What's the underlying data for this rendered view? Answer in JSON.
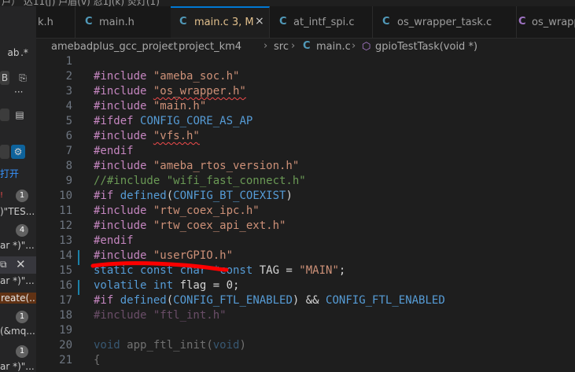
{
  "topbar_fragment": "戸）  込11(ʃ)  戸眉(v)  忍1J(k)  炎灯(1)",
  "sidebar": {
    "regex_icon": ".*",
    "ab_icon": "ab",
    "more_dots": "···",
    "item_open": "打开",
    "rows": [
      {
        "text": ")\"TES...",
        "badge": "1"
      },
      {
        "text": "ar *)\"...",
        "badge": "4"
      },
      {
        "text": "ar *)\"...",
        "badge": ""
      },
      {
        "text": "reate(...",
        "badge": ""
      },
      {
        "text": "(&mq...",
        "badge": "1"
      },
      {
        "text": "ar *)\"...",
        "badge": "1"
      }
    ]
  },
  "tabs": [
    {
      "icon": "C",
      "label": "k.h",
      "active": false
    },
    {
      "icon": "C",
      "label": "main.h",
      "active": false
    },
    {
      "icon": "C",
      "label": "main.c 3, M",
      "active": true
    },
    {
      "icon": "C",
      "label": "at_intf_spi.c",
      "active": false
    },
    {
      "icon": "C",
      "label": "os_wrapper_task.c",
      "active": false
    },
    {
      "icon": "C",
      "label": "os_wrapp",
      "active": false
    }
  ],
  "tab_close": "×",
  "breadcrumb": {
    "parts": [
      "amebadplus_gcc_project",
      "project_km4",
      "src",
      "main.c",
      "gpioTestTask(void *)"
    ],
    "file_icon": "C",
    "symbol_icon": "cube-icon"
  },
  "editor": {
    "line_numbers": [
      "1",
      "2",
      "3",
      "4",
      "5",
      "6",
      "7",
      "8",
      "9",
      "10",
      "11",
      "12",
      "13",
      "14",
      "15",
      "16",
      "17",
      "18",
      "19",
      "20",
      "21"
    ],
    "lines": [
      [],
      [
        {
          "t": "#include ",
          "c": "kw"
        },
        {
          "t": "\"ameba_soc.h\"",
          "c": "str"
        }
      ],
      [
        {
          "t": "#include ",
          "c": "kw"
        },
        {
          "t": "\"os_wrapper.h\"",
          "c": "str squig"
        }
      ],
      [
        {
          "t": "#include ",
          "c": "kw"
        },
        {
          "t": "\"main.h\"",
          "c": "str"
        }
      ],
      [
        {
          "t": "#ifdef ",
          "c": "kw"
        },
        {
          "t": "CONFIG_CORE_AS_AP",
          "c": "mac"
        }
      ],
      [
        {
          "t": "#include ",
          "c": "kw"
        },
        {
          "t": "\"vfs.h\"",
          "c": "str squig"
        }
      ],
      [
        {
          "t": "#endif",
          "c": "kw"
        }
      ],
      [
        {
          "t": "#include ",
          "c": "kw"
        },
        {
          "t": "\"ameba_rtos_version.h\"",
          "c": "str"
        }
      ],
      [
        {
          "t": "//#include \"wifi_fast_connect.h\"",
          "c": "cmt"
        }
      ],
      [
        {
          "t": "#if ",
          "c": "kw"
        },
        {
          "t": "defined",
          "c": "typ"
        },
        {
          "t": "(",
          "c": ""
        },
        {
          "t": "CONFIG_BT_COEXIST",
          "c": "mac"
        },
        {
          "t": ")",
          "c": ""
        }
      ],
      [
        {
          "t": "#include ",
          "c": "kw"
        },
        {
          "t": "\"rtw_coex_ipc.h\"",
          "c": "str"
        }
      ],
      [
        {
          "t": "#include ",
          "c": "kw"
        },
        {
          "t": "\"rtw_coex_api_ext.h\"",
          "c": "str"
        }
      ],
      [
        {
          "t": "#endif",
          "c": "kw"
        }
      ],
      [
        {
          "t": "#include ",
          "c": "kw"
        },
        {
          "t": "\"userGPIO.h\"",
          "c": "str"
        }
      ],
      [
        {
          "t": "static const char *const ",
          "c": "typ"
        },
        {
          "t": "TAG = ",
          "c": ""
        },
        {
          "t": "\"MAIN\"",
          "c": "str"
        },
        {
          "t": ";",
          "c": ""
        }
      ],
      [
        {
          "t": "volatile int ",
          "c": "typ"
        },
        {
          "t": "flag = 0;",
          "c": ""
        }
      ],
      [
        {
          "t": "#if ",
          "c": "kw"
        },
        {
          "t": "defined",
          "c": "typ"
        },
        {
          "t": "(",
          "c": ""
        },
        {
          "t": "CONFIG_FTL_ENABLED",
          "c": "mac"
        },
        {
          "t": ") && ",
          "c": ""
        },
        {
          "t": "CONFIG_FTL_ENABLED",
          "c": "mac"
        }
      ],
      [
        {
          "t": "#include \"ftl_int.h\"",
          "c": "kw dim"
        }
      ],
      [],
      [
        {
          "t": "void ",
          "c": "typ dim"
        },
        {
          "t": "app_ftl_init",
          "c": "dim"
        },
        {
          "t": "(",
          "c": "dim"
        },
        {
          "t": "void",
          "c": "typ dim"
        },
        {
          "t": ")",
          "c": "dim"
        }
      ],
      [
        {
          "t": "{",
          "c": "dim"
        }
      ]
    ]
  },
  "colors": {
    "accent": "#0078d4",
    "modified_tab_label": "#e2c08d",
    "c_file_icon": "#519aba",
    "annotation_stroke": "#ff0000"
  }
}
